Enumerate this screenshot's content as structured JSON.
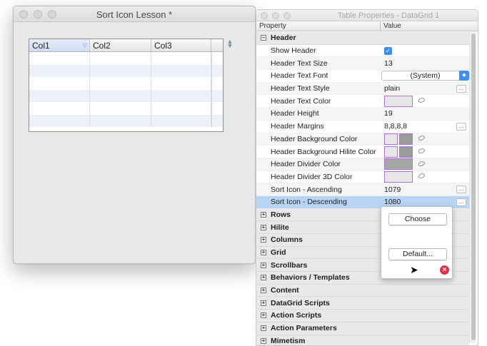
{
  "left_window": {
    "title": "Sort Icon Lesson *",
    "grid": {
      "columns": [
        "Col1",
        "Col2",
        "Col3"
      ],
      "sort_indicator": "sort-descending-icon"
    }
  },
  "right_window": {
    "title": "Table Properties - DataGrid 1",
    "column_headers": {
      "property": "Property",
      "value": "Value"
    },
    "header_section": {
      "label": "Header",
      "expand_symbol": "−",
      "rows": [
        {
          "name": "Show Header",
          "kind": "checkbox",
          "checked": true
        },
        {
          "name": "Header Text Size",
          "kind": "text",
          "value": "13"
        },
        {
          "name": "Header Text Font",
          "kind": "select",
          "value": "(System)"
        },
        {
          "name": "Header Text Style",
          "kind": "text_button",
          "value": "plain"
        },
        {
          "name": "Header Text Color",
          "kind": "color",
          "value": "#e6e6e6"
        },
        {
          "name": "Header Height",
          "kind": "text",
          "value": "19"
        },
        {
          "name": "Header Margins",
          "kind": "text_button",
          "value": "8,8,8,8"
        },
        {
          "name": "Header Background Color",
          "kind": "color2"
        },
        {
          "name": "Header Background Hilite Color",
          "kind": "color2"
        },
        {
          "name": "Header Divider Color",
          "kind": "color",
          "value": "#a6a6a6"
        },
        {
          "name": "Header Divider 3D Color",
          "kind": "color",
          "value": "#e6e6e6"
        },
        {
          "name": "Sort Icon - Ascending",
          "kind": "text_button",
          "value": "1079"
        },
        {
          "name": "Sort Icon - Descending",
          "kind": "text_button",
          "value": "1080",
          "selected": true
        }
      ]
    },
    "collapsed_sections": [
      "Rows",
      "Hilite",
      "Columns",
      "Grid",
      "Scrollbars",
      "Behaviors / Templates",
      "Content",
      "DataGrid Scripts",
      "Action Scripts",
      "Action Parameters",
      "Mimetism"
    ],
    "collapsed_symbol": "+",
    "ellipsis_label": "...",
    "checkmark": "✓"
  },
  "popover": {
    "choose_label": "Choose",
    "default_label": "Default...",
    "close_symbol": "×"
  },
  "colors": {
    "selection": "#b7d3f5",
    "accent": "#3d8ef7",
    "swatch_border": "#b070e0",
    "error": "#e0314b"
  }
}
